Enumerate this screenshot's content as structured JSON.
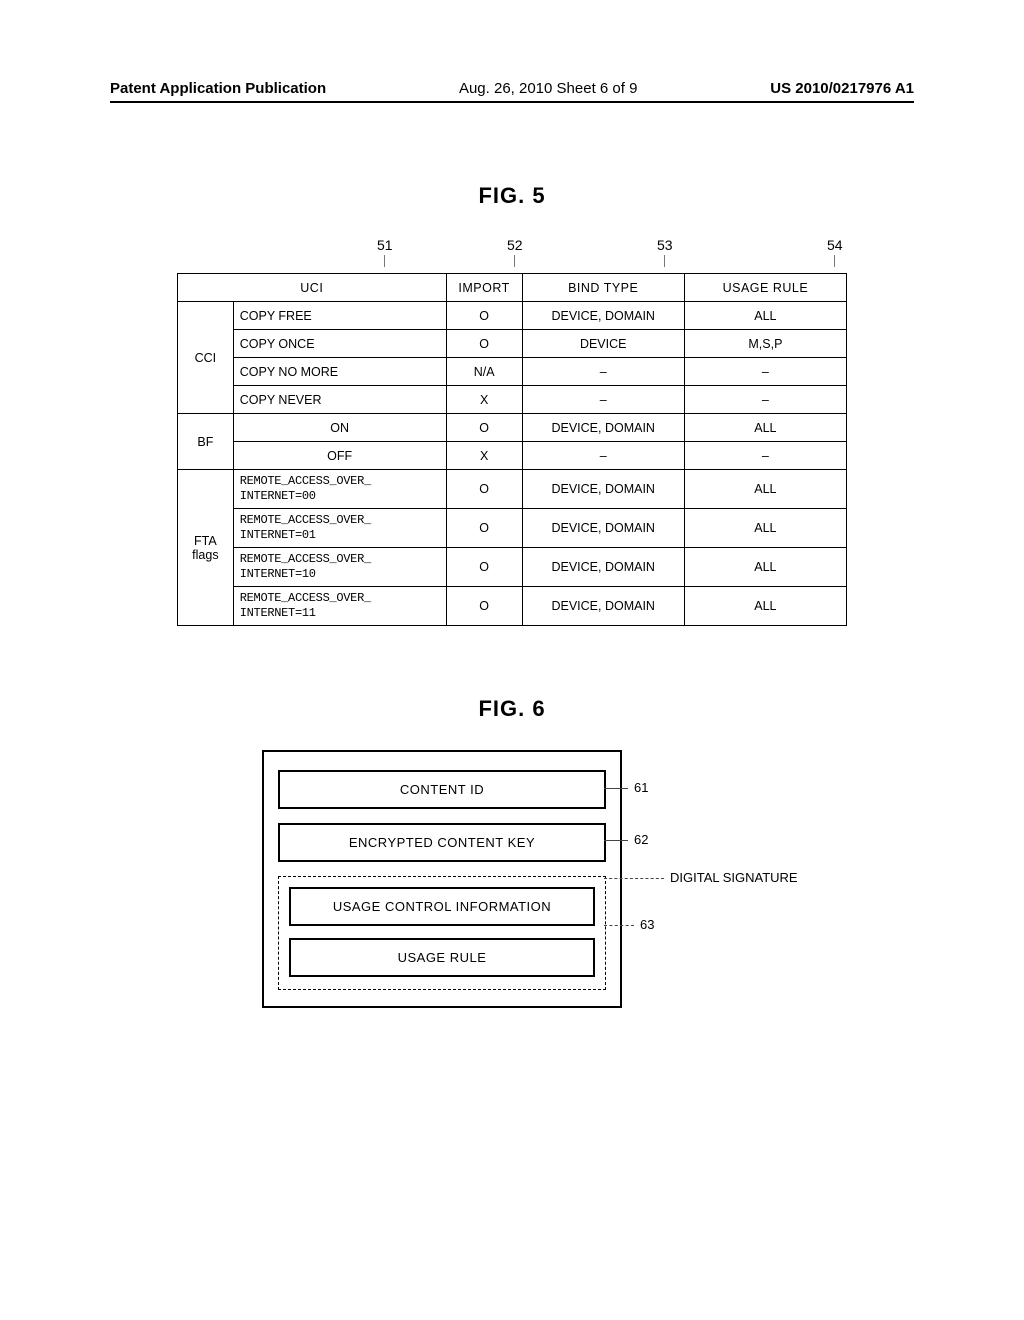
{
  "header": {
    "left": "Patent Application Publication",
    "mid": "Aug. 26, 2010  Sheet 6 of 9",
    "right": "US 2010/0217976 A1"
  },
  "fig5": {
    "title": "FIG. 5",
    "callouts": {
      "c1": "51",
      "c2": "52",
      "c3": "53",
      "c4": "54"
    },
    "headers": {
      "uci": "UCI",
      "import": "IMPORT",
      "bind": "BIND TYPE",
      "usage": "USAGE RULE"
    },
    "groups": [
      {
        "cat": "CCI",
        "rows": [
          {
            "val": "COPY FREE",
            "import": "O",
            "bind": "DEVICE, DOMAIN",
            "usage": "ALL"
          },
          {
            "val": "COPY ONCE",
            "import": "O",
            "bind": "DEVICE",
            "usage": "M,S,P"
          },
          {
            "val": "COPY NO MORE",
            "import": "N/A",
            "bind": "–",
            "usage": "–"
          },
          {
            "val": "COPY NEVER",
            "import": "X",
            "bind": "–",
            "usage": "–"
          }
        ]
      },
      {
        "cat": "BF",
        "rows": [
          {
            "val": "ON",
            "import": "O",
            "bind": "DEVICE, DOMAIN",
            "usage": "ALL"
          },
          {
            "val": "OFF",
            "import": "X",
            "bind": "–",
            "usage": "–"
          }
        ]
      },
      {
        "cat": "FTA flags",
        "rows": [
          {
            "val": "REMOTE_ACCESS_OVER_\nINTERNET=00",
            "import": "O",
            "bind": "DEVICE, DOMAIN",
            "usage": "ALL"
          },
          {
            "val": "REMOTE_ACCESS_OVER_\nINTERNET=01",
            "import": "O",
            "bind": "DEVICE, DOMAIN",
            "usage": "ALL"
          },
          {
            "val": "REMOTE_ACCESS_OVER_\nINTERNET=10",
            "import": "O",
            "bind": "DEVICE, DOMAIN",
            "usage": "ALL"
          },
          {
            "val": "REMOTE_ACCESS_OVER_\nINTERNET=11",
            "import": "O",
            "bind": "DEVICE, DOMAIN",
            "usage": "ALL"
          }
        ]
      }
    ]
  },
  "fig6": {
    "title": "FIG. 6",
    "boxes": {
      "content_id": "CONTENT ID",
      "enc_key": "ENCRYPTED CONTENT KEY",
      "usage_ctrl": "USAGE CONTROL INFORMATION",
      "usage_rule": "USAGE RULE"
    },
    "labels": {
      "l61": "61",
      "l62": "62",
      "l63": "63",
      "sig": "DIGITAL SIGNATURE"
    }
  }
}
